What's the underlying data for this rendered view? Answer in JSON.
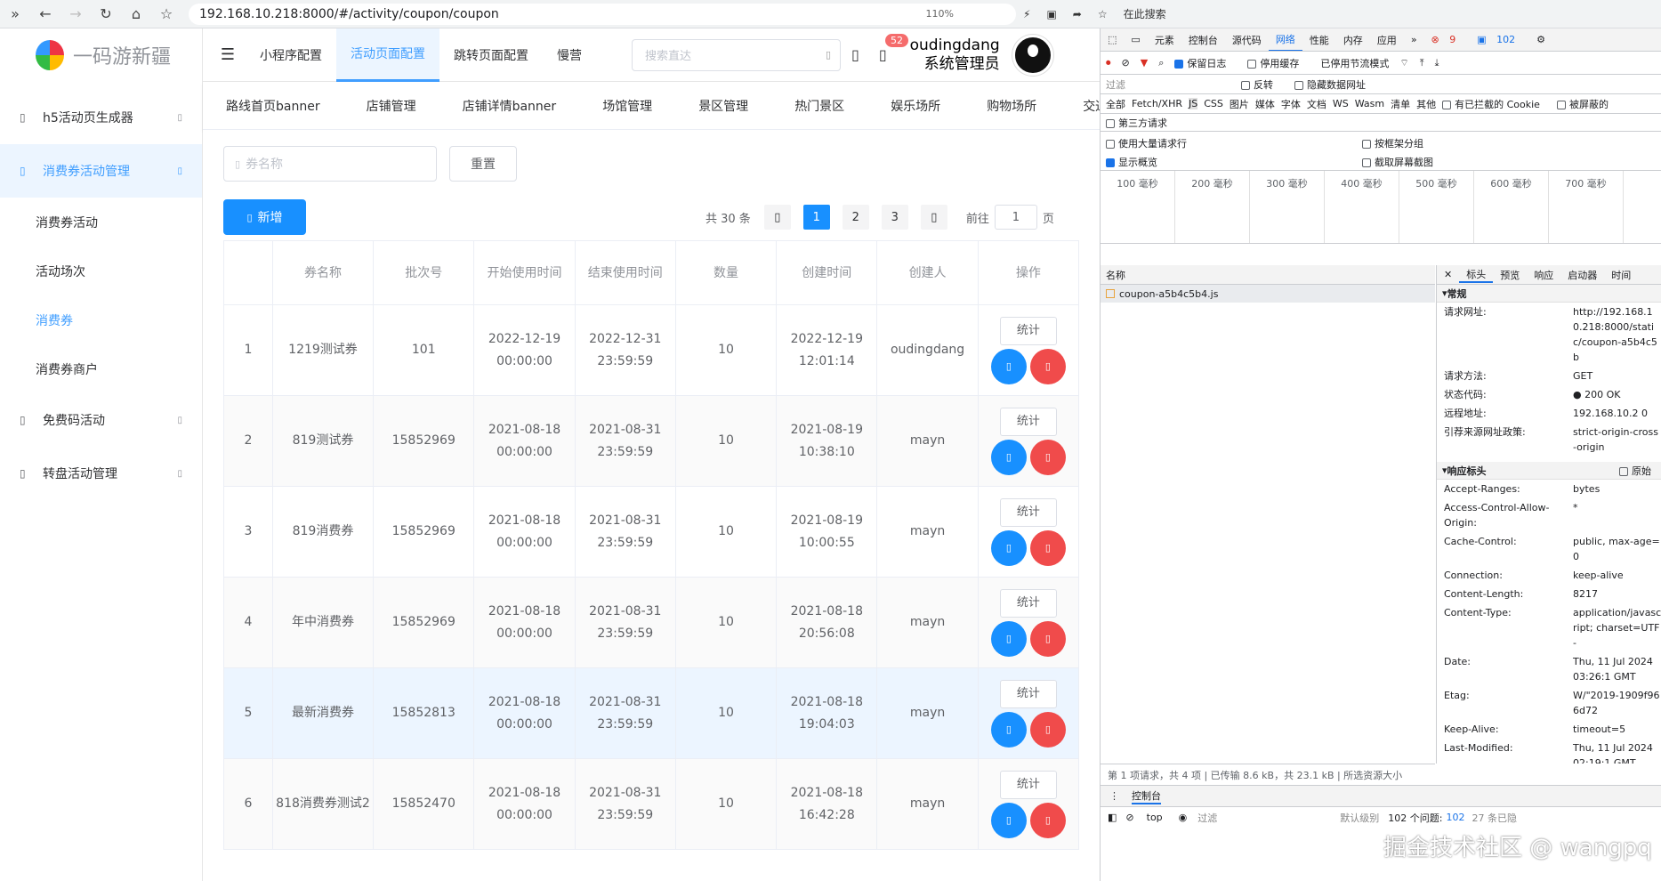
{
  "browser": {
    "url": "192.168.10.218:8000/#/activity/coupon/coupon",
    "zoom": "110%",
    "search_label": "在此搜索"
  },
  "sidebar": {
    "logo": "一码游新疆",
    "items": [
      {
        "label": "h5活动页生成器"
      },
      {
        "label": "消费券活动管理"
      },
      {
        "label": "免费码活动"
      },
      {
        "label": "转盘活动管理"
      }
    ],
    "sub_items": [
      {
        "label": "消费券活动"
      },
      {
        "label": "活动场次"
      },
      {
        "label": "消费券"
      },
      {
        "label": "消费券商户"
      }
    ]
  },
  "header": {
    "tabs": [
      {
        "label": "小程序配置"
      },
      {
        "label": "活动页面配置"
      },
      {
        "label": "跳转页面配置"
      },
      {
        "label": "慢营"
      }
    ],
    "search_placeholder": "搜索直达",
    "notif_count": "52",
    "username": "oudingdang",
    "role": "系统管理员"
  },
  "subnav": [
    "路线首页banner",
    "店铺管理",
    "店铺详情banner",
    "场馆管理",
    "景区管理",
    "热门景区",
    "娱乐场所",
    "购物场所",
    "交通出"
  ],
  "filter": {
    "coupon_placeholder": "券名称",
    "reset": "重置",
    "add": "新增"
  },
  "pagination": {
    "total": "共 30 条",
    "pages": [
      "1",
      "2",
      "3"
    ],
    "goto": "前往",
    "page_value": "1",
    "page_unit": "页"
  },
  "table": {
    "headers": [
      "",
      "券名称",
      "批次号",
      "开始使用时间",
      "结束使用时间",
      "数量",
      "创建时间",
      "创建人",
      "操作"
    ],
    "stat_label": "统计",
    "rows": [
      {
        "idx": "1",
        "name": "1219测试券",
        "batch": "101",
        "start": "2022-12-19 00:00:00",
        "end": "2022-12-31 23:59:59",
        "qty": "10",
        "created": "2022-12-19 12:01:14",
        "creator": "oudingdang"
      },
      {
        "idx": "2",
        "name": "819测试券",
        "batch": "15852969",
        "start": "2021-08-18 00:00:00",
        "end": "2021-08-31 23:59:59",
        "qty": "10",
        "created": "2021-08-19 10:38:10",
        "creator": "mayn"
      },
      {
        "idx": "3",
        "name": "819消费券",
        "batch": "15852969",
        "start": "2021-08-18 00:00:00",
        "end": "2021-08-31 23:59:59",
        "qty": "10",
        "created": "2021-08-19 10:00:55",
        "creator": "mayn"
      },
      {
        "idx": "4",
        "name": "年中消费券",
        "batch": "15852969",
        "start": "2021-08-18 00:00:00",
        "end": "2021-08-31 23:59:59",
        "qty": "10",
        "created": "2021-08-18 20:56:08",
        "creator": "mayn"
      },
      {
        "idx": "5",
        "name": "最新消费券",
        "batch": "15852813",
        "start": "2021-08-18 00:00:00",
        "end": "2021-08-31 23:59:59",
        "qty": "10",
        "created": "2021-08-18 19:04:03",
        "creator": "mayn"
      },
      {
        "idx": "6",
        "name": "818消费券测试2",
        "batch": "15852470",
        "start": "2021-08-18 00:00:00",
        "end": "2021-08-31 23:59:59",
        "qty": "10",
        "created": "2021-08-18 16:42:28",
        "creator": "mayn"
      }
    ]
  },
  "devtools": {
    "tabs": [
      "元素",
      "控制台",
      "源代码",
      "网络",
      "性能",
      "内存",
      "应用"
    ],
    "error_count": "9",
    "msg_count": "102",
    "toolbar": [
      "保留日志",
      "停用缓存",
      "已停用节流模式"
    ],
    "filter_label": "过滤",
    "filter_opts": [
      "反转",
      "隐藏数据网址"
    ],
    "types": [
      "全部",
      "Fetch/XHR",
      "JS",
      "CSS",
      "图片",
      "媒体",
      "字体",
      "文档",
      "WS",
      "Wasm",
      "清单",
      "其他",
      "有已拦截的 Cookie",
      "被屏蔽的"
    ],
    "third_party": "第三方请求",
    "opt_big": "使用大量请求行",
    "opt_group": "按框架分组",
    "opt_overview": "显示概览",
    "opt_screens": "截取屏幕截图",
    "timeline": [
      "100 毫秒",
      "200 毫秒",
      "300 毫秒",
      "400 毫秒",
      "500 毫秒",
      "600 毫秒",
      "700 毫秒"
    ],
    "col_name": "名称",
    "request": "coupon-a5b4c5b4.js",
    "detail_tabs": [
      "标头",
      "预览",
      "响应",
      "启动器",
      "时间"
    ],
    "general_title": "常规",
    "general": [
      {
        "k": "请求网址:",
        "v": "http://192.168.10.218:8000/static/coupon-a5b4c5b"
      },
      {
        "k": "请求方法:",
        "v": "GET"
      },
      {
        "k": "状态代码:",
        "v": "● 200 OK"
      },
      {
        "k": "远程地址:",
        "v": "192.168.10.2 0"
      },
      {
        "k": "引荐来源网址政策:",
        "v": "strict-origin-cross-origin"
      }
    ],
    "resp_title": "响应标头",
    "raw_label": "原始",
    "resp": [
      {
        "k": "Accept-Ranges:",
        "v": "bytes"
      },
      {
        "k": "Access-Control-Allow-Origin:",
        "v": "*"
      },
      {
        "k": "Cache-Control:",
        "v": "public, max-age=0"
      },
      {
        "k": "Connection:",
        "v": "keep-alive"
      },
      {
        "k": "Content-Length:",
        "v": "8217"
      },
      {
        "k": "Content-Type:",
        "v": "application/javascript; charset=UTF-"
      },
      {
        "k": "Date:",
        "v": "Thu, 11 Jul 2024 03:26:1 GMT"
      },
      {
        "k": "Etag:",
        "v": "W/\"2019-1909f966d72"
      },
      {
        "k": "Keep-Alive:",
        "v": "timeout=5"
      },
      {
        "k": "Last-Modified:",
        "v": "Thu, 11 Jul 2024 02:19:1 GMT"
      }
    ],
    "status": "第 1 项请求，共 4 项  |  已传输 8.6 kB，共 23.1 kB  |  所选资源大小",
    "drawer_tab": "控制台",
    "console_ctx": "top",
    "console_filter": "过滤",
    "console_level": "默认级别",
    "console_issues": "102 个问题:",
    "console_issue_count": "102",
    "console_hidden": "27 条已隐"
  },
  "watermark": "掘金技术社区 @ wangpq"
}
